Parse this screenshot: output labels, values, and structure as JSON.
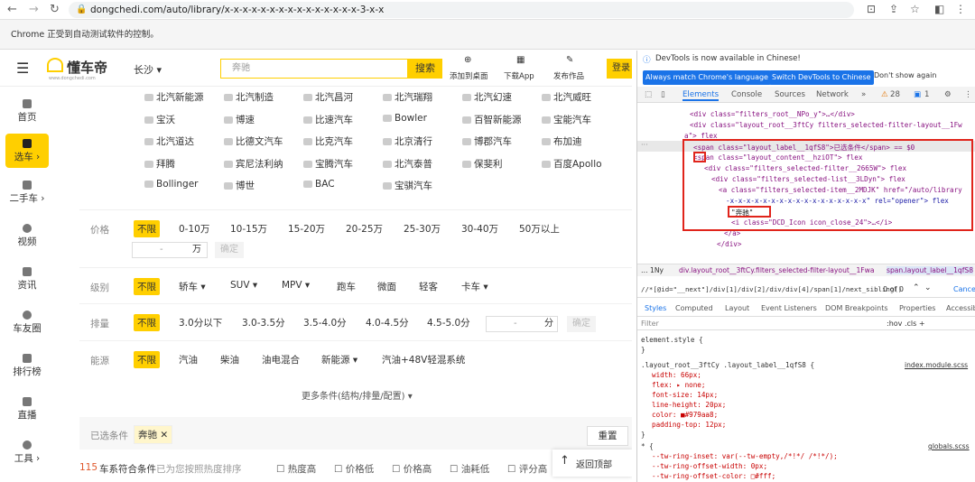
{
  "browser": {
    "url": "dongchedi.com/auto/library/x-x-x-x-x-x-x-x-x-x-x-x-x-x-x-3-x-x",
    "infobar": "Chrome 正受到自动测试软件的控制。"
  },
  "site": {
    "logo": "懂车帝",
    "logo_sub": "www.dongchedi.com",
    "city": "长沙 ▾",
    "search_value": "奔驰",
    "search_btn": "搜索",
    "header_links": [
      "添加到桌面",
      "下载App",
      "发布作品",
      "登录"
    ],
    "sidebar": [
      "首页",
      "选车 ›",
      "二手车 ›",
      "视频",
      "资讯",
      "车友圈",
      "排行榜",
      "直播",
      "工具 ›"
    ],
    "brands": [
      "北汽新能源",
      "北汽制造",
      "北汽昌河",
      "北汽瑞翔",
      "北汽幻速",
      "北汽威旺",
      "宝沃",
      "博速",
      "比速汽车",
      "Bowler",
      "百智新能源",
      "宝能汽车",
      "北汽道达",
      "比德文汽车",
      "比克汽车",
      "北京清行",
      "博郡汽车",
      "布加迪",
      "拜腾",
      "宾尼法利纳",
      "宝腾汽车",
      "北汽泰普",
      "保斐利",
      "百度Apollo",
      "Bollinger",
      "博世",
      "BAC",
      "宝骐汽车"
    ],
    "filters": {
      "price": {
        "label": "价格",
        "options": [
          "不限",
          "0-10万",
          "10-15万",
          "15-20万",
          "20-25万",
          "25-30万",
          "30-40万",
          "50万以上"
        ],
        "range_dash": "-",
        "range_unit": "万",
        "ok": "确定"
      },
      "level": {
        "label": "级别",
        "options": [
          "不限",
          "轿车 ▾",
          "SUV ▾",
          "MPV ▾",
          "跑车",
          "微面",
          "轻客",
          "卡车 ▾"
        ]
      },
      "displacement": {
        "label": "排量",
        "options": [
          "不限",
          "3.0分以下",
          "3.0-3.5分",
          "3.5-4.0分",
          "4.0-4.5分",
          "4.5-5.0分"
        ],
        "range_dash": "-",
        "range_unit": "分",
        "ok": "确定"
      },
      "energy": {
        "label": "能源",
        "options": [
          "不限",
          "汽油",
          "柴油",
          "油电混合",
          "新能源 ▾",
          "汽油+48V轻混系统"
        ]
      },
      "more": "更多条件(结构/排量/配置) ▾"
    },
    "selected": {
      "label": "已选条件",
      "chip": "奔驰 ✕",
      "reset": "重置"
    },
    "results": {
      "count": "115",
      "text": "车系符合条件",
      "sort_hint": "已为您按照热度排序",
      "sorts": [
        "热度高",
        "价格低",
        "价格高",
        "油耗低",
        "评分高"
      ]
    },
    "back_top": "返回顶部"
  },
  "devtools": {
    "notice": "DevTools is now available in Chinese!",
    "btn_match": "Always match Chrome's language",
    "btn_switch": "Switch DevTools to Chinese",
    "btn_dont": "Don't show again",
    "tabs": [
      "Elements",
      "Console",
      "Sources",
      "Network",
      "»"
    ],
    "warn_count": "28",
    "msg_count": "1",
    "dom_lines": [
      "<div class=\"filters_root__NPo_y\">…</div>",
      "<div class=\"layout_root__3ftCy filters_selected-filter-layout__1Fw",
      "a\"> flex",
      "<span class=\"layout_label__1qfS8\">已选条件</span> == $0",
      "<span class=\"layout_content__hziOT\"> flex",
      "<div class=\"filters_selected-filter__2665W\"> flex",
      "<div class=\"filters_selected-list__3LDyn\"> flex",
      "<a class=\"filters_selected-item__2MDJK\" href=\"/auto/library",
      "-x-x-x-x-x-x-x-x-x-x-x-x-x-x-x-x-x\" rel=\"opener\"> flex",
      "\"奔驰\"",
      "<i class=\"DCD_Icon icon_close_24\">…</i>",
      "</a>",
      "</div>"
    ],
    "breadcrumb": [
      "… 1Ny",
      "div.layout_root__3ftCy.filters_selected-filter-layout__1Fwa",
      "span.layout_label__1qfS8"
    ],
    "search": "//*[@id=\"__next\"]/div[1]/div[2]/div/div[4]/span[1]/next_sibling()",
    "search_count": "0 of 0",
    "cancel": "Cancel",
    "style_tabs": [
      "Styles",
      "Computed",
      "Layout",
      "Event Listeners",
      "DOM Breakpoints",
      "Properties",
      "Accessibility"
    ],
    "filter": "Filter",
    "filter_opts": ":hov .cls +",
    "css_lines": [
      "element.style {",
      "}",
      ".layout_root__3ftCy .layout_label__1qfS8 {",
      "width: 66px;",
      "flex: ▸ none;",
      "font-size: 14px;",
      "line-height: 20px;",
      "color: ■#979aa8;",
      "padding-top: 12px;",
      "}",
      "* {",
      "--tw-ring-inset: var(--tw-empty,/*!*/ /*!*/);",
      "--tw-ring-offset-width: 0px;",
      "--tw-ring-offset-color: □#fff;"
    ],
    "css_sources": [
      "index.module.scss",
      "globals.scss"
    ]
  },
  "colors": {
    "accent": "#ffcf00",
    "highlight": "#e0241b",
    "devtools_blue": "#1a73e8",
    "result_count": "#e0582b"
  }
}
